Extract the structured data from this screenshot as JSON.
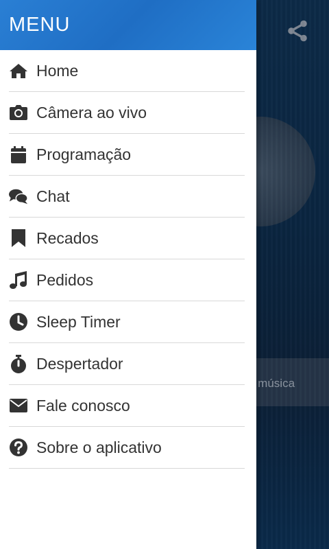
{
  "drawer": {
    "title": "MENU",
    "items": [
      {
        "label": "Home",
        "icon": "home-icon"
      },
      {
        "label": "Câmera ao vivo",
        "icon": "camera-icon"
      },
      {
        "label": "Programação",
        "icon": "calendar-icon"
      },
      {
        "label": "Chat",
        "icon": "chat-icon"
      },
      {
        "label": "Recados",
        "icon": "bookmark-icon"
      },
      {
        "label": "Pedidos",
        "icon": "music-note-icon"
      },
      {
        "label": "Sleep Timer",
        "icon": "clock-icon"
      },
      {
        "label": "Despertador",
        "icon": "stopwatch-icon"
      },
      {
        "label": "Fale conosco",
        "icon": "envelope-icon"
      },
      {
        "label": "Sobre o aplicativo",
        "icon": "question-circle-icon"
      }
    ]
  },
  "background_app": {
    "share_icon": "share-icon",
    "song_text": "a música"
  },
  "colors": {
    "header_blue": "#2a7fd4",
    "icon_dark": "#333333",
    "divider": "#d8d8d8"
  }
}
